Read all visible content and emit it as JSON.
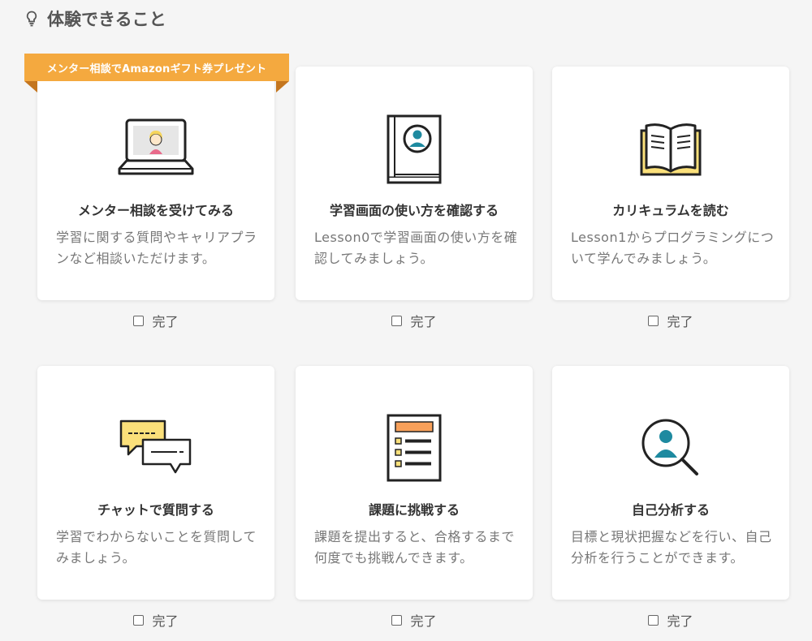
{
  "section": {
    "title": "体験できること",
    "icon": "lightbulb-icon"
  },
  "ribbon": {
    "label": "メンター相談でAmazonギフト券プレゼント",
    "color": "#f4a93f"
  },
  "cards": [
    {
      "title": "メンター相談を受けてみる",
      "desc": "学習に関する質問やキャリアプランなど相談いただけます。",
      "icon": "laptop-mentor-icon",
      "done_label": "完了"
    },
    {
      "title": "学習画面の使い方を確認する",
      "desc": "Lesson0で学習画面の使い方を確認してみましょう。",
      "icon": "book-profile-icon",
      "done_label": "完了"
    },
    {
      "title": "カリキュラムを読む",
      "desc": "Lesson1からプログラミングについて学んでみましょう。",
      "icon": "open-book-icon",
      "done_label": "完了"
    },
    {
      "title": "チャットで質問する",
      "desc": "学習でわからないことを質問してみましょう。",
      "icon": "chat-bubbles-icon",
      "done_label": "完了"
    },
    {
      "title": "課題に挑戦する",
      "desc": "課題を提出すると、合格するまで何度でも挑戦んできます。",
      "icon": "checklist-icon",
      "done_label": "完了"
    },
    {
      "title": "自己分析する",
      "desc": "目標と現状把握などを行い、自己分析を行うことができます。",
      "icon": "magnifier-person-icon",
      "done_label": "完了"
    }
  ],
  "colors": {
    "accent_orange": "#f4a93f",
    "teal": "#1e8aa0",
    "yellow": "#fbe07a"
  }
}
